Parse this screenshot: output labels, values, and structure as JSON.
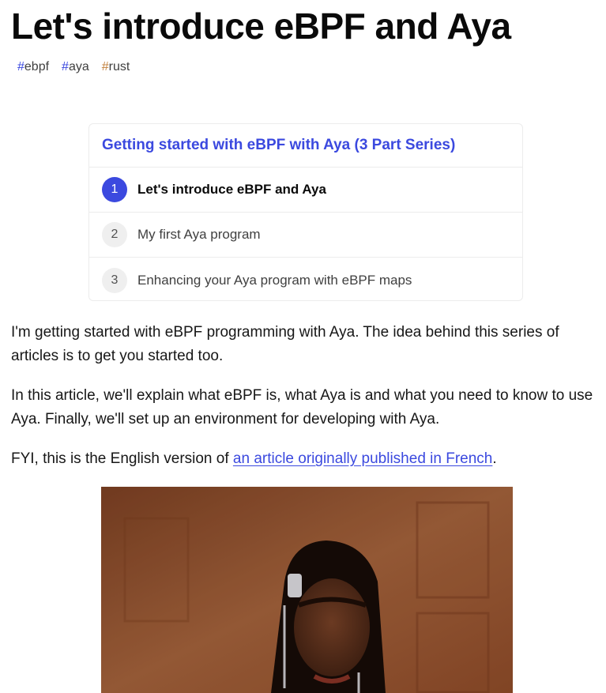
{
  "article": {
    "title": "Let's introduce eBPF and Aya",
    "tags": [
      {
        "hash": "#",
        "name": "ebpf",
        "color": "#3b49df"
      },
      {
        "hash": "#",
        "name": "aya",
        "color": "#3b49df"
      },
      {
        "hash": "#",
        "name": "rust",
        "color": "#c2813d"
      }
    ]
  },
  "series": {
    "title": "Getting started with eBPF with Aya (3 Part Series)",
    "items": [
      {
        "number": "1",
        "title": "Let's introduce eBPF and Aya",
        "current": true
      },
      {
        "number": "2",
        "title": "My first Aya program",
        "current": false
      },
      {
        "number": "3",
        "title": "Enhancing your Aya program with eBPF maps",
        "current": false
      }
    ]
  },
  "body": {
    "p1": "I'm getting started with eBPF programming with Aya. The idea behind this series of articles is to get you started too.",
    "p2": "In this article, we'll explain what eBPF is, what Aya is and what you need to know to use Aya. Finally, we'll set up an environment for developing with Aya.",
    "p3_prefix": "FYI, this is the English version of ",
    "p3_link": "an article originally published in French",
    "p3_suffix": "."
  },
  "colors": {
    "accent": "#3b49df",
    "rust_tag": "#c2813d"
  }
}
